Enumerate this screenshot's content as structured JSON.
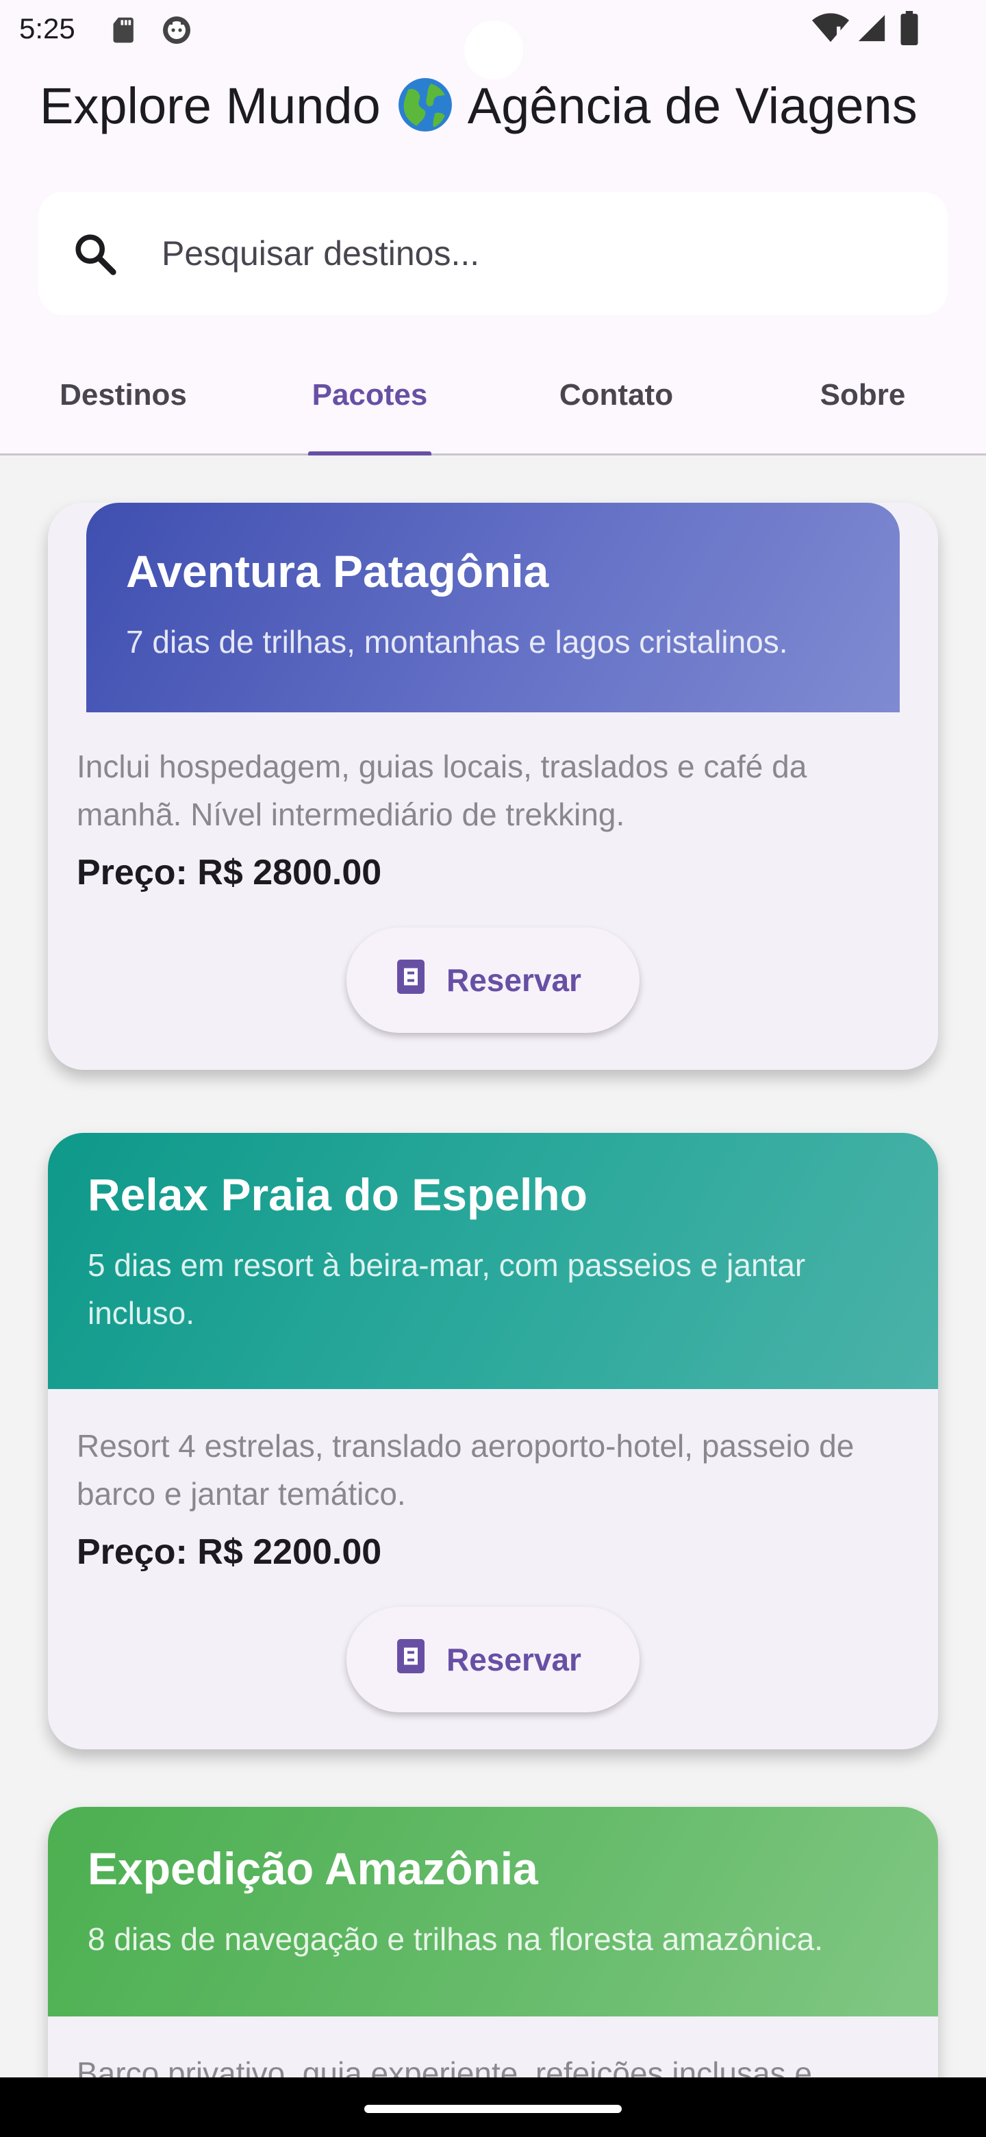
{
  "status_bar": {
    "time": "5:25"
  },
  "header": {
    "title_prefix": "Explore Mundo",
    "title_suffix": "Agência de Viagens",
    "search_placeholder": "Pesquisar destinos..."
  },
  "tabs": [
    {
      "label": "Destinos",
      "active": false
    },
    {
      "label": "Pacotes",
      "active": true
    },
    {
      "label": "Contato",
      "active": false
    },
    {
      "label": "Sobre",
      "active": false
    }
  ],
  "packages": [
    {
      "title": "Aventura Patagônia",
      "subtitle": "7 dias de trilhas, montanhas e lagos cristalinos.",
      "description": "Inclui hospedagem, guias locais, traslados e café da manhã. Nível intermediário de trekking.",
      "price": "Preço: R$ 2800.00",
      "button": "Reservar",
      "color": "#3f51b5"
    },
    {
      "title": "Relax Praia do Espelho",
      "subtitle": "5 dias em resort à beira-mar, com passeios e jantar incluso.",
      "description": "Resort 4 estrelas, translado aeroporto-hotel, passeio de barco e jantar temático.",
      "price": "Preço: R$ 2200.00",
      "button": "Reservar",
      "color": "#009688"
    },
    {
      "title": "Expedição Amazônia",
      "subtitle": "8 dias de navegação e trilhas na floresta amazônica.",
      "description": "Barco privativo, guia experiente, refeições inclusas e",
      "color": "#4caf50"
    }
  ],
  "colors": {
    "accent": "#6750a4",
    "background": "#fdf7fe"
  },
  "icons": [
    "sd-card-icon",
    "android-icon",
    "wifi-icon",
    "signal-icon",
    "battery-icon",
    "search-icon",
    "globe-icon",
    "ticket-icon"
  ]
}
